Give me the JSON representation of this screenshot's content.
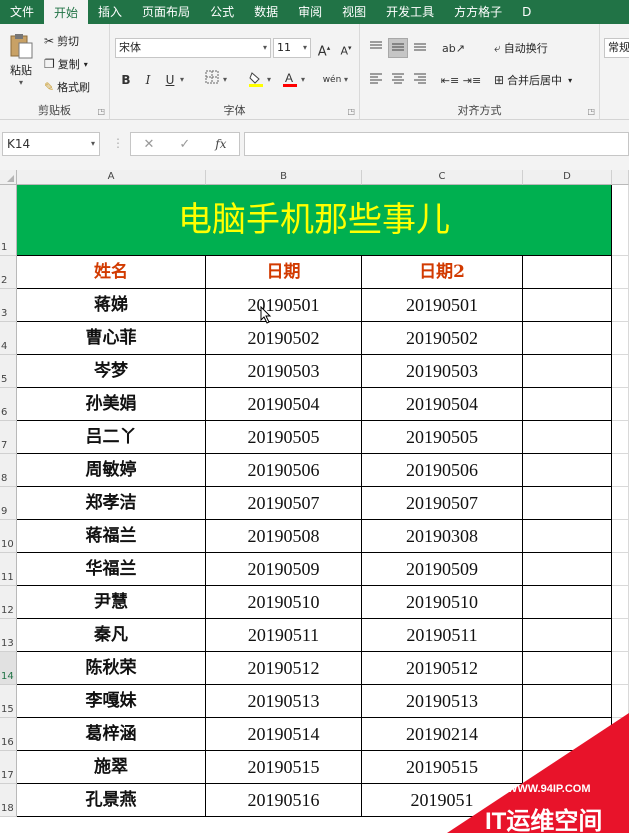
{
  "tabs": [
    "文件",
    "开始",
    "插入",
    "页面布局",
    "公式",
    "数据",
    "审阅",
    "视图",
    "开发工具",
    "方方格子",
    "D"
  ],
  "active_tab": 1,
  "ribbon": {
    "clipboard": {
      "paste": "粘贴",
      "cut": "剪切",
      "copy": "复制",
      "format_painter": "格式刷",
      "label": "剪贴板"
    },
    "font": {
      "name": "宋体",
      "size": "11",
      "grow": "A",
      "shrink": "A",
      "bold": "B",
      "italic": "I",
      "underline": "U",
      "phonetic": "wén",
      "label": "字体"
    },
    "alignment": {
      "wrap": "自动换行",
      "merge": "合并后居中",
      "label": "对齐方式"
    },
    "number": {
      "format": "常规"
    }
  },
  "formula_bar": {
    "name_box": "K14",
    "cancel": "✕",
    "enter": "✓",
    "fx": "fx",
    "value": ""
  },
  "columns": [
    "A",
    "B",
    "C",
    "D"
  ],
  "rows": [
    "1",
    "2",
    "3",
    "4",
    "5",
    "6",
    "7",
    "8",
    "9",
    "10",
    "11",
    "12",
    "13",
    "14",
    "15",
    "16",
    "17",
    "18"
  ],
  "selected_row": "14",
  "sheet": {
    "banner": "电脑手机那些事儿",
    "headers": [
      "姓名",
      "日期",
      "日期2"
    ],
    "records": [
      [
        "蒋娣",
        "20190501",
        "20190501"
      ],
      [
        "曹心菲",
        "20190502",
        "20190502"
      ],
      [
        "岑梦",
        "20190503",
        "20190503"
      ],
      [
        "孙美娟",
        "20190504",
        "20190504"
      ],
      [
        "吕二丫",
        "20190505",
        "20190505"
      ],
      [
        "周敏婷",
        "20190506",
        "20190506"
      ],
      [
        "郑孝洁",
        "20190507",
        "20190507"
      ],
      [
        "蒋福兰",
        "20190508",
        "20190308"
      ],
      [
        "华福兰",
        "20190509",
        "20190509"
      ],
      [
        "尹慧",
        "20190510",
        "20190510"
      ],
      [
        "秦凡",
        "20190511",
        "20190511"
      ],
      [
        "陈秋荣",
        "20190512",
        "20190512"
      ],
      [
        "李嘎妹",
        "20190513",
        "20190513"
      ],
      [
        "葛梓涵",
        "20190514",
        "20190214"
      ],
      [
        "施翠",
        "20190515",
        "20190515"
      ],
      [
        "孔景燕",
        "20190516",
        "2019051"
      ]
    ]
  },
  "watermark": {
    "url": "WWW.94IP.COM",
    "brand": "IT运维空间"
  },
  "colors": {
    "excel_green": "#217346",
    "banner_bg": "#00b050",
    "banner_text": "#ffff00",
    "header_text": "#d23a00",
    "watermark_red": "#e8132a"
  }
}
